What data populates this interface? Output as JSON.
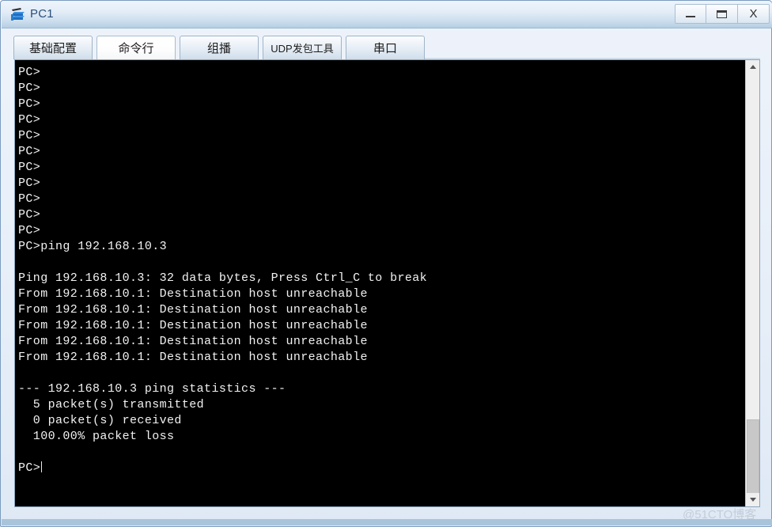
{
  "window": {
    "title": "PC1",
    "icon": "network-device-icon",
    "border_color": "#7a9cbf",
    "titlebar_gradient_top": "#eef4fb",
    "titlebar_gradient_bottom": "#b5cee3"
  },
  "controls": {
    "minimize_label": "–",
    "maximize_label": "▭",
    "close_label": "X",
    "minimize_name": "minimize-button",
    "maximize_name": "maximize-button",
    "close_name": "close-button"
  },
  "tabs": [
    {
      "label": "基础配置",
      "active": false
    },
    {
      "label": "命令行",
      "active": true
    },
    {
      "label": "组播",
      "active": false
    },
    {
      "label": "UDP发包工具",
      "active": false
    },
    {
      "label": "串口",
      "active": false
    }
  ],
  "terminal": {
    "background": "#000000",
    "foreground": "#f2f2f2",
    "prompt": "PC>",
    "cursor_visible": true,
    "lines": [
      "PC>",
      "PC>",
      "PC>",
      "PC>",
      "PC>",
      "PC>",
      "PC>",
      "PC>",
      "PC>",
      "PC>",
      "PC>",
      "PC>ping 192.168.10.3",
      "",
      "Ping 192.168.10.3: 32 data bytes, Press Ctrl_C to break",
      "From 192.168.10.1: Destination host unreachable",
      "From 192.168.10.1: Destination host unreachable",
      "From 192.168.10.1: Destination host unreachable",
      "From 192.168.10.1: Destination host unreachable",
      "From 192.168.10.1: Destination host unreachable",
      "",
      "--- 192.168.10.3 ping statistics ---",
      "  5 packet(s) transmitted",
      "  0 packet(s) received",
      "  100.00% packet loss",
      ""
    ],
    "last_line": "PC>"
  },
  "ping_result": {
    "command": "ping 192.168.10.3",
    "target_ip": "192.168.10.3",
    "source_ip": "192.168.10.1",
    "data_bytes": 32,
    "break_hint": "Press Ctrl_C to break",
    "error_message": "Destination host unreachable",
    "error_count": 5,
    "packets_transmitted": 5,
    "packets_received": 0,
    "packet_loss": "100.00%"
  },
  "scrollbar": {
    "up_arrow": "chevron-up-icon",
    "down_arrow": "chevron-down-icon",
    "thumb_position_percent": 86
  },
  "watermark": {
    "text": "@51CTO博客"
  }
}
